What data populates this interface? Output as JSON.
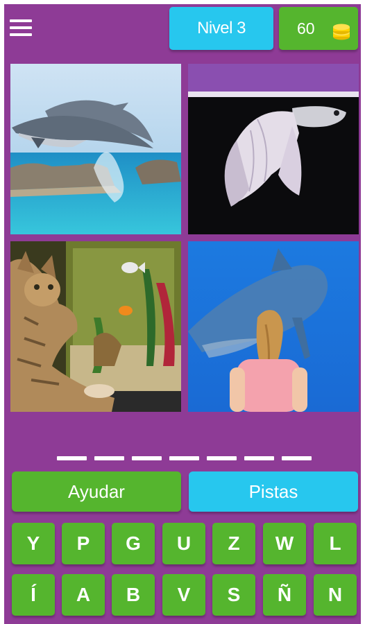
{
  "header": {
    "level_label": "Nivel 3",
    "coins": "60",
    "menu_icon": "hamburger-menu-icon",
    "coin_icon": "coin-stack-icon"
  },
  "images": [
    {
      "subject": "dolphins-icon"
    },
    {
      "subject": "betta-fish-icon"
    },
    {
      "subject": "cat-aquarium-icon"
    },
    {
      "subject": "shark-girl-icon"
    }
  ],
  "answer": {
    "slot_count": 7
  },
  "actions": {
    "help_label": "Ayudar",
    "hints_label": "Pistas"
  },
  "keyboard": {
    "row1": [
      "Y",
      "P",
      "G",
      "U",
      "Z",
      "W",
      "L"
    ],
    "row2": [
      "Í",
      "A",
      "B",
      "V",
      "S",
      "Ñ",
      "N"
    ]
  },
  "colors": {
    "background": "#8e3b96",
    "green": "#55b52e",
    "cyan": "#27c7ee",
    "coin": "#ffd300"
  }
}
